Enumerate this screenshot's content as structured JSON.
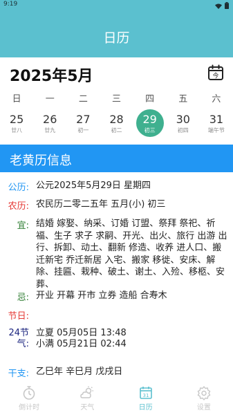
{
  "status_bar": {
    "time": "9:19"
  },
  "header": {
    "title": "日历"
  },
  "month": {
    "label": "2025年5月",
    "today_icon_glyph": "今"
  },
  "weekdays": [
    "日",
    "一",
    "二",
    "三",
    "四",
    "五",
    "六"
  ],
  "dates": [
    {
      "day": "25",
      "lunar": "廿八"
    },
    {
      "day": "26",
      "lunar": "廿九"
    },
    {
      "day": "27",
      "lunar": "初一"
    },
    {
      "day": "28",
      "lunar": "初二"
    },
    {
      "day": "29",
      "lunar": "初三",
      "selected": true
    },
    {
      "day": "30",
      "lunar": "初四"
    },
    {
      "day": "31",
      "lunar": "端午节"
    }
  ],
  "section": {
    "title": "老黄历信息"
  },
  "info": {
    "gongli": {
      "label": "公历:",
      "value": "公元2025年5月29日 星期四"
    },
    "nongli": {
      "label": "农历:",
      "value": "农民历二零二五年 五月(小) 初三"
    },
    "yi": {
      "label": "宜:",
      "value": "结婚 嫁娶、纳采、订婚 订盟、祭拜 祭祀、祈福、生子 求子 求嗣、开光、出火、旅行 出游 出行、拆卸、动土、翻新 修造、收养 进人口、搬迁新宅 乔迁新居 入宅、搬家 移徙、安床、解除、挂匾、栽种、破土、谢土、入殓、移柩、安葬、"
    },
    "ji": {
      "label": "忌:",
      "value": "开业 开幕 开市 立券 造船 合寿木"
    },
    "jieri": {
      "label": "节日:",
      "value": ""
    },
    "jieqi": {
      "label_line1": "24节",
      "label_line2": "气:",
      "line1": "立夏 05月05日 13:48",
      "line2": "小满 05月21日 02:44"
    },
    "ganzhi": {
      "label": "干支:",
      "value": "乙巳年 辛巳月 戊戌日"
    }
  },
  "nav": [
    {
      "label": "倒计时",
      "icon": "stopwatch-icon",
      "active": false
    },
    {
      "label": "天气",
      "icon": "weather-icon",
      "active": false
    },
    {
      "label": "日历",
      "icon": "calendar-icon",
      "active": true
    },
    {
      "label": "设置",
      "icon": "settings-icon",
      "active": false
    }
  ],
  "colors": {
    "header": "#5bc0cf",
    "section_bar": "#2196f3",
    "selected_date": "#3fb08f",
    "gongli_label": "#2196f3",
    "nongli_label": "#e53935",
    "yi_label": "#2e7d32",
    "ji_label": "#2e7d32",
    "jieri_label": "#e53935",
    "jieqi_label": "#1a237e",
    "ganzhi_label": "#2196f3"
  }
}
